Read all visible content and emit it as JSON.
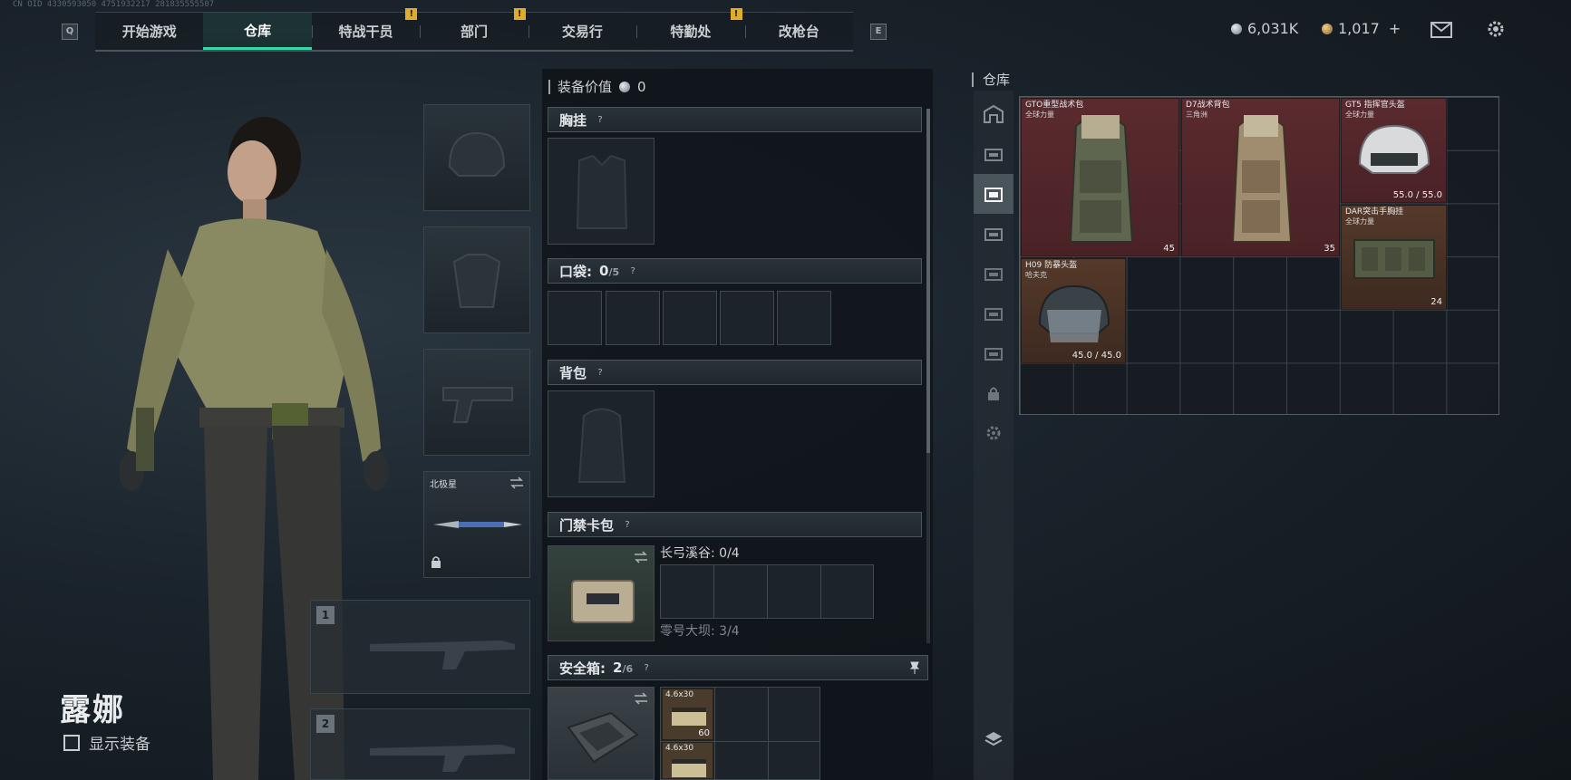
{
  "top_nav": {
    "left_key": "Q",
    "right_key": "E",
    "tabs": [
      {
        "label": "开始游戏",
        "active": false,
        "alert": false
      },
      {
        "label": "仓库",
        "active": true,
        "alert": false
      },
      {
        "label": "特战干员",
        "active": false,
        "alert": true
      },
      {
        "label": "部门",
        "active": false,
        "alert": true
      },
      {
        "label": "交易行",
        "active": false,
        "alert": false
      },
      {
        "label": "特勤处",
        "active": false,
        "alert": true
      },
      {
        "label": "改枪台",
        "active": false,
        "alert": false
      }
    ],
    "alert_glyph": "!",
    "silver_amount": "6,031K",
    "gold_amount": "1,017",
    "gold_plus": "+"
  },
  "character": {
    "name": "露娜",
    "show_equipment_label": "显示装备",
    "melee_name": "北极星",
    "weapon_slot_1": "1",
    "weapon_slot_2": "2"
  },
  "loadout": {
    "value_label": "装备价值",
    "value": "0",
    "chest_rig": {
      "title": "胸挂",
      "help": "?"
    },
    "pockets": {
      "title": "口袋:",
      "count": "0",
      "capacity": "/5",
      "help": "?"
    },
    "backpack": {
      "title": "背包",
      "help": "?"
    },
    "keycard": {
      "title": "门禁卡包",
      "help": "?",
      "map1_label": "长弓溪谷: 0/4",
      "map2_label": "零号大坝: 3/4"
    },
    "safebox": {
      "title": "安全箱:",
      "count": "2",
      "capacity": "/6",
      "help": "?",
      "items": [
        {
          "label": "4.6x30",
          "qty": "60"
        },
        {
          "label": "4.6x30",
          "qty": ""
        }
      ]
    }
  },
  "warehouse": {
    "title": "仓库",
    "items": [
      {
        "name": "GTO重型战术包",
        "sub": "全球力量",
        "badge": "45",
        "color": "red"
      },
      {
        "name": "D7战术背包",
        "sub": "三角洲",
        "badge": "35",
        "color": "red"
      },
      {
        "name": "GT5 指挥官头盔",
        "sub": "全球力量",
        "badge": "55.0 / 55.0",
        "color": "red"
      },
      {
        "name": "DAR突击手胸挂",
        "sub": "全球力量",
        "badge": "24",
        "color": "brown"
      },
      {
        "name": "H09 防暴头盔",
        "sub": "哈夫克",
        "badge": "45.0 / 45.0",
        "color": "brown"
      }
    ]
  },
  "colors": {
    "accent": "#39d7a8",
    "alert": "#e0ad2b",
    "rarity_red": "#5a2a2e",
    "rarity_brown": "#55392a"
  },
  "icons": [
    "mail-icon",
    "settings-icon",
    "lock-icon",
    "swap-icon",
    "pin-icon",
    "layers-icon",
    "helmet-icon",
    "backpack-icon"
  ]
}
